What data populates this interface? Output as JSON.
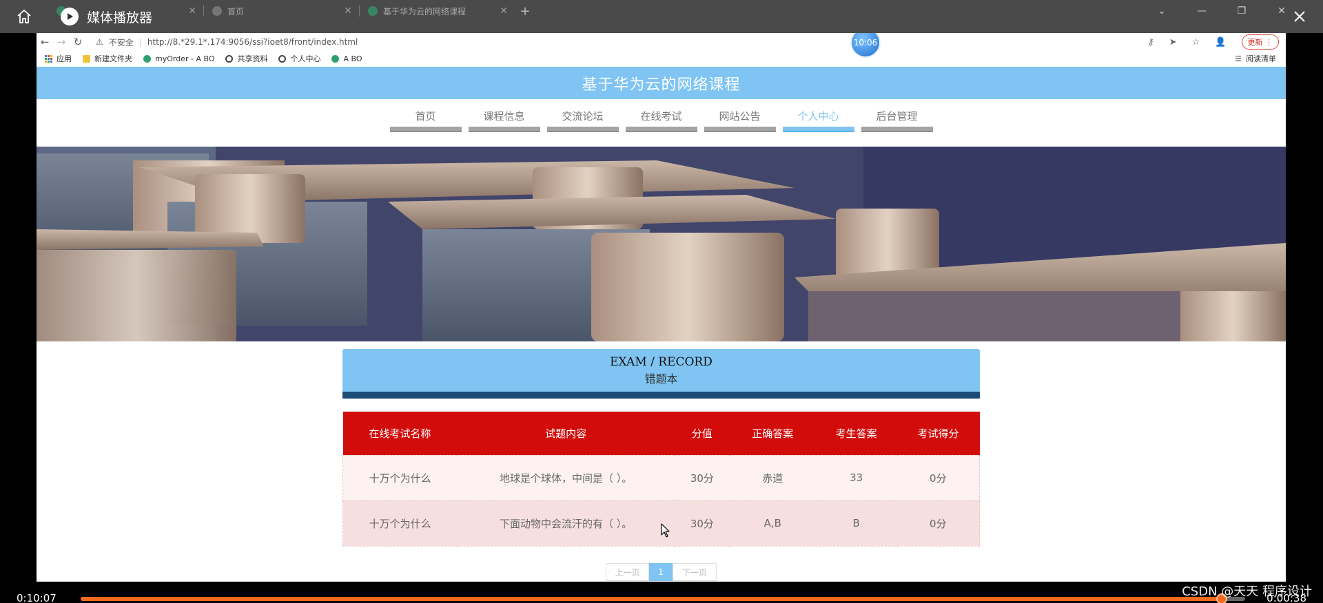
{
  "player": {
    "title": "媒体播放器",
    "current_time": "0:10:07",
    "remaining_time": "0:00:38",
    "progress_fraction": 0.98,
    "watermark": "CSDN @天天 程序设计"
  },
  "browser": {
    "tabs": [
      {
        "title": ""
      },
      {
        "title": "首页"
      },
      {
        "title": "基于华为云的网络课程"
      }
    ],
    "address": {
      "security_label": "不安全",
      "url": "http://8.*29.1*.174:9056/ssi?ioet8/front/index.html"
    },
    "update_label": "更新",
    "bookmarks": [
      {
        "label": "应用",
        "icon": "apps-grid-icon"
      },
      {
        "label": "新建文件夹",
        "icon": "folder-icon"
      },
      {
        "label": "myOrder - A BO",
        "icon": "vue-icon"
      },
      {
        "label": "共享资料",
        "icon": "globe-icon"
      },
      {
        "label": "个人中心",
        "icon": "globe-icon"
      },
      {
        "label": "A BO",
        "icon": "vue-icon"
      }
    ],
    "reading_list": "阅读清单",
    "clock": "10:06"
  },
  "site": {
    "title": "基于华为云的网络课程",
    "nav": [
      {
        "label": "首页",
        "active": false
      },
      {
        "label": "课程信息",
        "active": false
      },
      {
        "label": "交流论坛",
        "active": false
      },
      {
        "label": "在线考试",
        "active": false
      },
      {
        "label": "网站公告",
        "active": false
      },
      {
        "label": "个人中心",
        "active": true
      },
      {
        "label": "后台管理",
        "active": false
      }
    ],
    "section": {
      "title_en": "EXAM / RECORD",
      "title_cn": "错题本"
    },
    "table": {
      "headers": [
        "在线考试名称",
        "试题内容",
        "分值",
        "正确答案",
        "考生答案",
        "考试得分"
      ],
      "rows": [
        [
          "十万个为什么",
          "地球是个球体，中间是（ ）。",
          "30分",
          "赤道",
          "33",
          "0分"
        ],
        [
          "十万个为什么",
          "下面动物中会流汗的有（ ）。",
          "30分",
          "A,B",
          "B",
          "0分"
        ]
      ]
    },
    "pager": {
      "prev": "上一页",
      "current": "1",
      "next": "下一页"
    }
  },
  "colors": {
    "accent_blue": "#7fc4f2",
    "table_header_red": "#d20b0b",
    "progress_orange": "#f26a1f"
  }
}
